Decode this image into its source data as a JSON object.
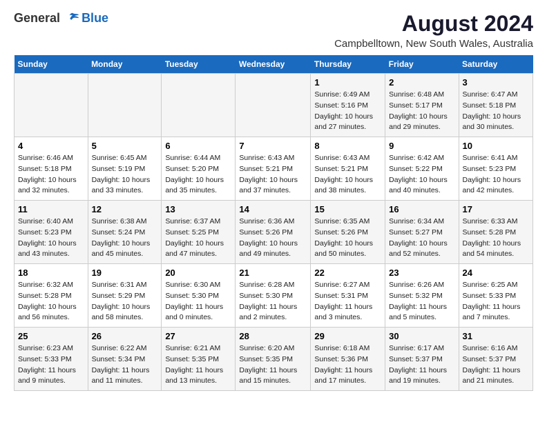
{
  "logo": {
    "line1": "General",
    "line2": "Blue"
  },
  "title": "August 2024",
  "subtitle": "Campbelltown, New South Wales, Australia",
  "headers": [
    "Sunday",
    "Monday",
    "Tuesday",
    "Wednesday",
    "Thursday",
    "Friday",
    "Saturday"
  ],
  "weeks": [
    [
      {
        "day": "",
        "info": ""
      },
      {
        "day": "",
        "info": ""
      },
      {
        "day": "",
        "info": ""
      },
      {
        "day": "",
        "info": ""
      },
      {
        "day": "1",
        "info": "Sunrise: 6:49 AM\nSunset: 5:16 PM\nDaylight: 10 hours\nand 27 minutes."
      },
      {
        "day": "2",
        "info": "Sunrise: 6:48 AM\nSunset: 5:17 PM\nDaylight: 10 hours\nand 29 minutes."
      },
      {
        "day": "3",
        "info": "Sunrise: 6:47 AM\nSunset: 5:18 PM\nDaylight: 10 hours\nand 30 minutes."
      }
    ],
    [
      {
        "day": "4",
        "info": "Sunrise: 6:46 AM\nSunset: 5:18 PM\nDaylight: 10 hours\nand 32 minutes."
      },
      {
        "day": "5",
        "info": "Sunrise: 6:45 AM\nSunset: 5:19 PM\nDaylight: 10 hours\nand 33 minutes."
      },
      {
        "day": "6",
        "info": "Sunrise: 6:44 AM\nSunset: 5:20 PM\nDaylight: 10 hours\nand 35 minutes."
      },
      {
        "day": "7",
        "info": "Sunrise: 6:43 AM\nSunset: 5:21 PM\nDaylight: 10 hours\nand 37 minutes."
      },
      {
        "day": "8",
        "info": "Sunrise: 6:43 AM\nSunset: 5:21 PM\nDaylight: 10 hours\nand 38 minutes."
      },
      {
        "day": "9",
        "info": "Sunrise: 6:42 AM\nSunset: 5:22 PM\nDaylight: 10 hours\nand 40 minutes."
      },
      {
        "day": "10",
        "info": "Sunrise: 6:41 AM\nSunset: 5:23 PM\nDaylight: 10 hours\nand 42 minutes."
      }
    ],
    [
      {
        "day": "11",
        "info": "Sunrise: 6:40 AM\nSunset: 5:23 PM\nDaylight: 10 hours\nand 43 minutes."
      },
      {
        "day": "12",
        "info": "Sunrise: 6:38 AM\nSunset: 5:24 PM\nDaylight: 10 hours\nand 45 minutes."
      },
      {
        "day": "13",
        "info": "Sunrise: 6:37 AM\nSunset: 5:25 PM\nDaylight: 10 hours\nand 47 minutes."
      },
      {
        "day": "14",
        "info": "Sunrise: 6:36 AM\nSunset: 5:26 PM\nDaylight: 10 hours\nand 49 minutes."
      },
      {
        "day": "15",
        "info": "Sunrise: 6:35 AM\nSunset: 5:26 PM\nDaylight: 10 hours\nand 50 minutes."
      },
      {
        "day": "16",
        "info": "Sunrise: 6:34 AM\nSunset: 5:27 PM\nDaylight: 10 hours\nand 52 minutes."
      },
      {
        "day": "17",
        "info": "Sunrise: 6:33 AM\nSunset: 5:28 PM\nDaylight: 10 hours\nand 54 minutes."
      }
    ],
    [
      {
        "day": "18",
        "info": "Sunrise: 6:32 AM\nSunset: 5:28 PM\nDaylight: 10 hours\nand 56 minutes."
      },
      {
        "day": "19",
        "info": "Sunrise: 6:31 AM\nSunset: 5:29 PM\nDaylight: 10 hours\nand 58 minutes."
      },
      {
        "day": "20",
        "info": "Sunrise: 6:30 AM\nSunset: 5:30 PM\nDaylight: 11 hours\nand 0 minutes."
      },
      {
        "day": "21",
        "info": "Sunrise: 6:28 AM\nSunset: 5:30 PM\nDaylight: 11 hours\nand 2 minutes."
      },
      {
        "day": "22",
        "info": "Sunrise: 6:27 AM\nSunset: 5:31 PM\nDaylight: 11 hours\nand 3 minutes."
      },
      {
        "day": "23",
        "info": "Sunrise: 6:26 AM\nSunset: 5:32 PM\nDaylight: 11 hours\nand 5 minutes."
      },
      {
        "day": "24",
        "info": "Sunrise: 6:25 AM\nSunset: 5:33 PM\nDaylight: 11 hours\nand 7 minutes."
      }
    ],
    [
      {
        "day": "25",
        "info": "Sunrise: 6:23 AM\nSunset: 5:33 PM\nDaylight: 11 hours\nand 9 minutes."
      },
      {
        "day": "26",
        "info": "Sunrise: 6:22 AM\nSunset: 5:34 PM\nDaylight: 11 hours\nand 11 minutes."
      },
      {
        "day": "27",
        "info": "Sunrise: 6:21 AM\nSunset: 5:35 PM\nDaylight: 11 hours\nand 13 minutes."
      },
      {
        "day": "28",
        "info": "Sunrise: 6:20 AM\nSunset: 5:35 PM\nDaylight: 11 hours\nand 15 minutes."
      },
      {
        "day": "29",
        "info": "Sunrise: 6:18 AM\nSunset: 5:36 PM\nDaylight: 11 hours\nand 17 minutes."
      },
      {
        "day": "30",
        "info": "Sunrise: 6:17 AM\nSunset: 5:37 PM\nDaylight: 11 hours\nand 19 minutes."
      },
      {
        "day": "31",
        "info": "Sunrise: 6:16 AM\nSunset: 5:37 PM\nDaylight: 11 hours\nand 21 minutes."
      }
    ]
  ]
}
